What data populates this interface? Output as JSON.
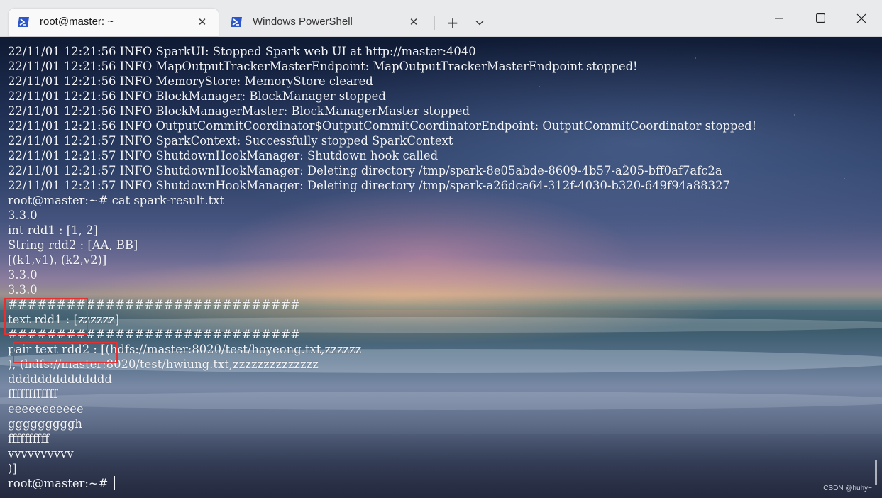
{
  "tabs": [
    {
      "label": "root@master: ~",
      "icon": "powershell-icon",
      "active": true
    },
    {
      "label": "Windows PowerShell",
      "icon": "powershell-icon",
      "active": false
    }
  ],
  "titlebar": {
    "new_tab_glyph": "+",
    "close_glyph": "✕"
  },
  "terminal": {
    "lines": [
      "22/11/01 12:21:56 INFO SparkUI: Stopped Spark web UI at http://master:4040",
      "22/11/01 12:21:56 INFO MapOutputTrackerMasterEndpoint: MapOutputTrackerMasterEndpoint stopped!",
      "22/11/01 12:21:56 INFO MemoryStore: MemoryStore cleared",
      "22/11/01 12:21:56 INFO BlockManager: BlockManager stopped",
      "22/11/01 12:21:56 INFO BlockManagerMaster: BlockManagerMaster stopped",
      "22/11/01 12:21:56 INFO OutputCommitCoordinator$OutputCommitCoordinatorEndpoint: OutputCommitCoordinator stopped!",
      "22/11/01 12:21:57 INFO SparkContext: Successfully stopped SparkContext",
      "22/11/01 12:21:57 INFO ShutdownHookManager: Shutdown hook called",
      "22/11/01 12:21:57 INFO ShutdownHookManager: Deleting directory /tmp/spark-8e05abde-8609-4b57-a205-bff0af7afc2a",
      "22/11/01 12:21:57 INFO ShutdownHookManager: Deleting directory /tmp/spark-a26dca64-312f-4030-b320-649f94a88327",
      "root@master:~# cat spark-result.txt",
      "3.3.0",
      "int rdd1 : [1, 2]",
      "String rdd2 : [AA, BB]",
      "[(k1,v1), (k2,v2)]",
      "3.3.0",
      "3.3.0",
      "##############################",
      "text rdd1 : [zzzzzz]",
      "##############################",
      "pair text rdd2 : [(hdfs://master:8020/test/hoyeong.txt,zzzzzz",
      "), (hdfs://master:8020/test/hwiung.txt,zzzzzzzzzzzzzz",
      "dddddddddddddd",
      "ffffffffffff",
      "eeeeeeeeeee",
      "gggggggggh",
      "ffffffffff",
      "vvvvvvvvvv",
      ")]",
      "root@master:~# "
    ]
  },
  "watermark": "CSDN @huhy~",
  "colors": {
    "highlight": "#e82f2f",
    "terminal_text": "#f2f4f8",
    "titlebar_bg": "#e9eaec",
    "powershell_blue": "#2c56c9"
  }
}
